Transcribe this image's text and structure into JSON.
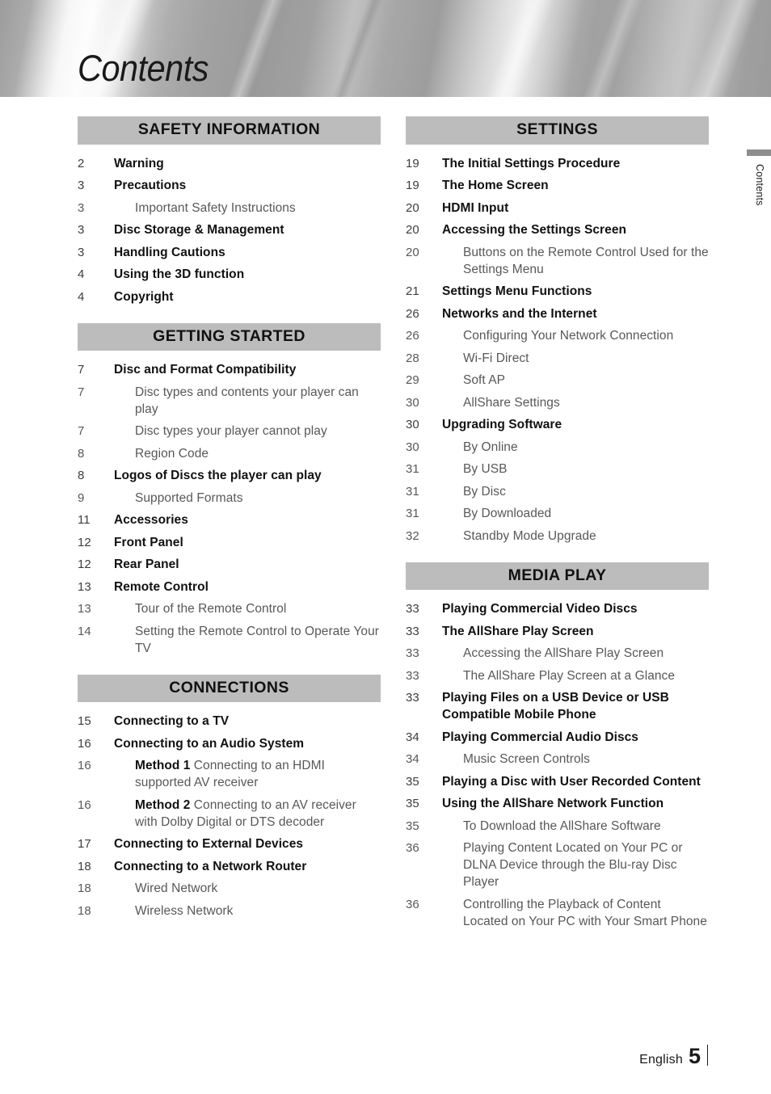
{
  "header": {
    "title": "Contents"
  },
  "side_tab": {
    "label": "Contents"
  },
  "footer": {
    "language": "English",
    "page_number": "5"
  },
  "colors": {
    "section_header_bg": "#BCBCBC",
    "bold_entry_text": "#111111",
    "sub_entry_text": "#58585A",
    "side_tab_bar": "#8D8D8D"
  },
  "columns": {
    "left": [
      {
        "header": "SAFETY INFORMATION",
        "entries": [
          {
            "page": "2",
            "title": "Warning",
            "level": "main"
          },
          {
            "page": "3",
            "title": "Precautions",
            "level": "main"
          },
          {
            "page": "3",
            "title": "Important Safety Instructions",
            "level": "sub"
          },
          {
            "page": "3",
            "title": "Disc Storage & Management",
            "level": "main"
          },
          {
            "page": "3",
            "title": "Handling Cautions",
            "level": "main"
          },
          {
            "page": "4",
            "title": "Using the 3D function",
            "level": "main"
          },
          {
            "page": "4",
            "title": "Copyright",
            "level": "main"
          }
        ]
      },
      {
        "header": "GETTING STARTED",
        "entries": [
          {
            "page": "7",
            "title": "Disc and Format Compatibility",
            "level": "main"
          },
          {
            "page": "7",
            "title": "Disc types and contents your player can play",
            "level": "sub"
          },
          {
            "page": "7",
            "title": "Disc types your player cannot play",
            "level": "sub"
          },
          {
            "page": "8",
            "title": "Region Code",
            "level": "sub"
          },
          {
            "page": "8",
            "title": "Logos of Discs the player can play",
            "level": "main"
          },
          {
            "page": "9",
            "title": "Supported Formats",
            "level": "sub"
          },
          {
            "page": "11",
            "title": "Accessories",
            "level": "main"
          },
          {
            "page": "12",
            "title": "Front Panel",
            "level": "main"
          },
          {
            "page": "12",
            "title": "Rear Panel",
            "level": "main"
          },
          {
            "page": "13",
            "title": "Remote Control",
            "level": "main"
          },
          {
            "page": "13",
            "title": "Tour of the Remote Control",
            "level": "sub"
          },
          {
            "page": "14",
            "title": "Setting the Remote Control to Operate Your TV",
            "level": "sub"
          }
        ]
      },
      {
        "header": "CONNECTIONS",
        "entries": [
          {
            "page": "15",
            "title": "Connecting to a TV",
            "level": "main"
          },
          {
            "page": "16",
            "title": "Connecting to an Audio System",
            "level": "main"
          },
          {
            "page": "16",
            "lead": "Method 1",
            "title": " Connecting to an HDMI supported AV receiver",
            "level": "sub"
          },
          {
            "page": "16",
            "lead": "Method 2",
            "title": " Connecting to an AV receiver with Dolby Digital or DTS decoder",
            "level": "sub"
          },
          {
            "page": "17",
            "title": "Connecting to External Devices",
            "level": "main"
          },
          {
            "page": "18",
            "title": "Connecting to a Network Router",
            "level": "main"
          },
          {
            "page": "18",
            "title": "Wired Network",
            "level": "sub"
          },
          {
            "page": "18",
            "title": "Wireless Network",
            "level": "sub"
          }
        ]
      }
    ],
    "right": [
      {
        "header": "SETTINGS",
        "entries": [
          {
            "page": "19",
            "title": "The Initial Settings Procedure",
            "level": "main"
          },
          {
            "page": "19",
            "title": "The Home Screen",
            "level": "main"
          },
          {
            "page": "20",
            "title": "HDMI Input",
            "level": "main"
          },
          {
            "page": "20",
            "title": "Accessing the Settings Screen",
            "level": "main"
          },
          {
            "page": "20",
            "title": "Buttons on the Remote Control Used for the Settings Menu",
            "level": "sub"
          },
          {
            "page": "21",
            "title": "Settings Menu Functions",
            "level": "main"
          },
          {
            "page": "26",
            "title": "Networks and the Internet",
            "level": "main"
          },
          {
            "page": "26",
            "title": "Configuring Your Network Connection",
            "level": "sub"
          },
          {
            "page": "28",
            "title": "Wi-Fi Direct",
            "level": "sub"
          },
          {
            "page": "29",
            "title": "Soft AP",
            "level": "sub"
          },
          {
            "page": "30",
            "title": "AllShare Settings",
            "level": "sub"
          },
          {
            "page": "30",
            "title": "Upgrading Software",
            "level": "main"
          },
          {
            "page": "30",
            "title": "By Online",
            "level": "sub"
          },
          {
            "page": "31",
            "title": "By USB",
            "level": "sub"
          },
          {
            "page": "31",
            "title": "By Disc",
            "level": "sub"
          },
          {
            "page": "31",
            "title": "By Downloaded",
            "level": "sub"
          },
          {
            "page": "32",
            "title": "Standby Mode Upgrade",
            "level": "sub"
          }
        ]
      },
      {
        "header": "MEDIA PLAY",
        "entries": [
          {
            "page": "33",
            "title": "Playing Commercial Video Discs",
            "level": "main"
          },
          {
            "page": "33",
            "title": "The AllShare Play Screen",
            "level": "main"
          },
          {
            "page": "33",
            "title": "Accessing the AllShare Play Screen",
            "level": "sub"
          },
          {
            "page": "33",
            "title": "The AllShare Play Screen at a Glance",
            "level": "sub"
          },
          {
            "page": "33",
            "title": "Playing Files on a USB Device or USB Compatible Mobile Phone",
            "level": "main"
          },
          {
            "page": "34",
            "title": "Playing Commercial Audio Discs",
            "level": "main"
          },
          {
            "page": "34",
            "title": "Music Screen Controls",
            "level": "sub"
          },
          {
            "page": "35",
            "title": "Playing a Disc with User Recorded Content",
            "level": "main"
          },
          {
            "page": "35",
            "title": "Using the AllShare Network Function",
            "level": "main"
          },
          {
            "page": "35",
            "title": "To Download the AllShare Software",
            "level": "sub"
          },
          {
            "page": "36",
            "title": "Playing Content Located on Your PC or DLNA Device through the Blu-ray Disc Player",
            "level": "sub"
          },
          {
            "page": "36",
            "title": "Controlling the Playback of Content Located on Your PC with Your Smart Phone",
            "level": "sub"
          }
        ]
      }
    ]
  }
}
